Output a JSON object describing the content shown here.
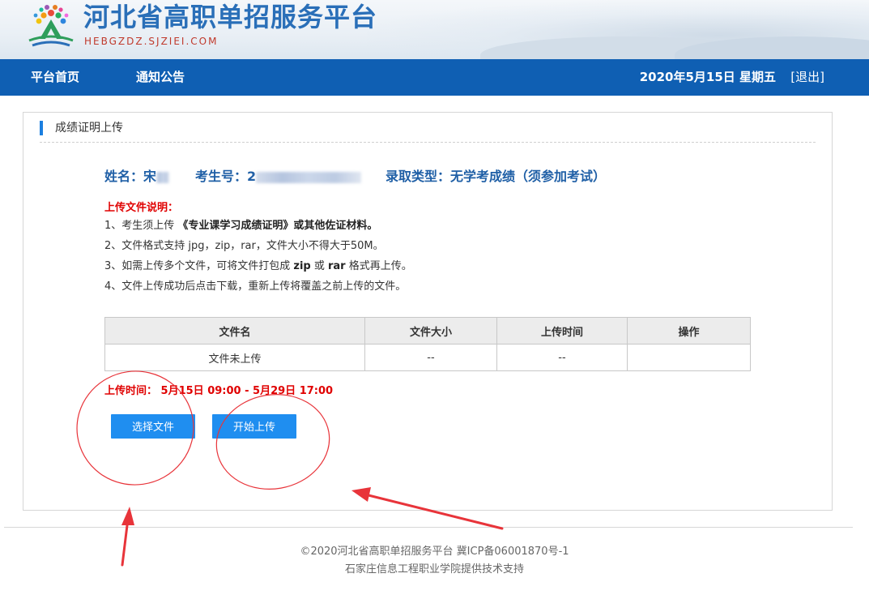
{
  "header": {
    "site_title": "河北省高职单招服务平台",
    "site_domain": "HEBGZDZ.SJZIEI.COM"
  },
  "nav": {
    "items": [
      {
        "label": "平台首页"
      },
      {
        "label": "通知公告"
      }
    ],
    "date": "2020年5月15日 星期五",
    "logout": "[退出]"
  },
  "panel": {
    "title": "成绩证明上传",
    "name_label": "姓名：宋",
    "exam_no_label": "考生号：2",
    "admission_type": "录取类型：无学考成绩（须参加考试）"
  },
  "notes": {
    "title": "上传文件说明：",
    "line1_prefix": "1、考生须上传 ",
    "line1_bold": "《专业课学习成绩证明》或其他佐证材料。",
    "line2": "2、文件格式支持 jpg，zip，rar，文件大小不得大于50M。",
    "line3_prefix": "3、如需上传多个文件，可将文件打包成 ",
    "line3_zip": "zip",
    "line3_or": " 或 ",
    "line3_rar": "rar",
    "line3_suffix": " 格式再上传。",
    "line4": "4、文件上传成功后点击下载，重新上传将覆盖之前上传的文件。"
  },
  "table": {
    "headers": [
      "文件名",
      "文件大小",
      "上传时间",
      "操作"
    ],
    "rows": [
      [
        "文件未上传",
        "--",
        "--",
        ""
      ]
    ]
  },
  "upload": {
    "time_label": "上传时间：",
    "time_range": "5月15日 09:00 - 5月29日 17:00",
    "choose_button": "选择文件",
    "start_button": "开始上传"
  },
  "footer": {
    "copyright": "©2020河北省高职单招服务平台  冀ICP备06001870号-1",
    "support": "石家庄信息工程职业学院提供技术支持"
  },
  "colors": {
    "nav_bg": "#0f5fb3",
    "accent": "#1f8ef0",
    "title_blue": "#1f5fa6",
    "alert_red": "#e00000",
    "annotation_red": "#e8343a"
  }
}
